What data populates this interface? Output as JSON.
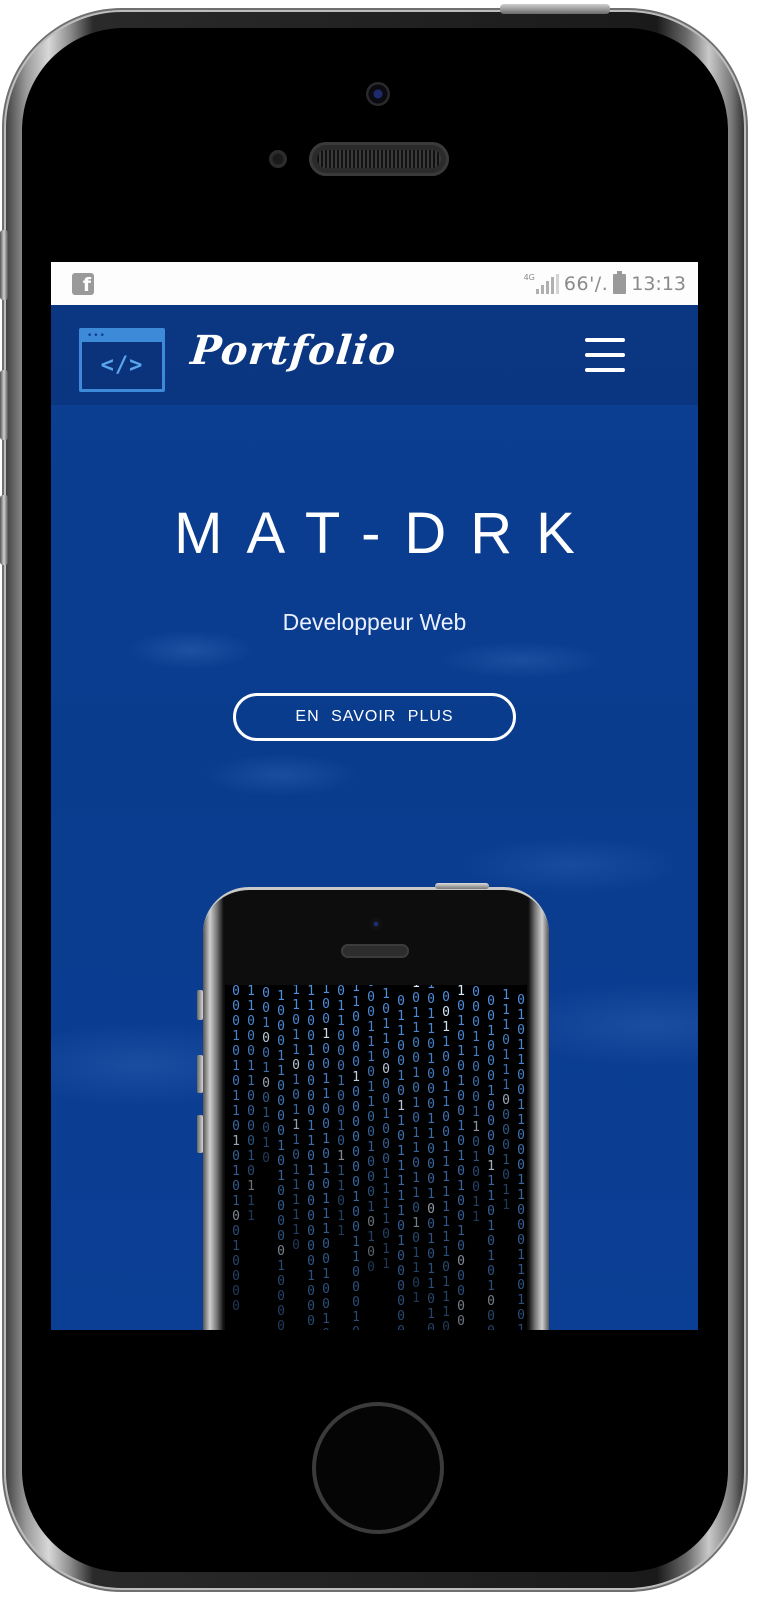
{
  "statusbar": {
    "app_icon": "facebook-icon",
    "network_type": "4G",
    "battery_percent": "66'/.",
    "time": "13:13"
  },
  "navbar": {
    "logo_icon": "code-window-icon",
    "logo_code": "</>",
    "brand": "Portfolio",
    "menu_icon": "hamburger-menu-icon"
  },
  "hero": {
    "title": "MAT-DRK",
    "subtitle": "Developpeur Web",
    "cta_label": "EN SAVOIR PLUS",
    "image_description": "matrix-binary-phone"
  },
  "colors": {
    "hero_background": "#0a3c8e",
    "logo_accent": "#3d8ad8",
    "statusbar_bg": "#fdfdfd",
    "binary_blue": "#4f8fe0"
  }
}
